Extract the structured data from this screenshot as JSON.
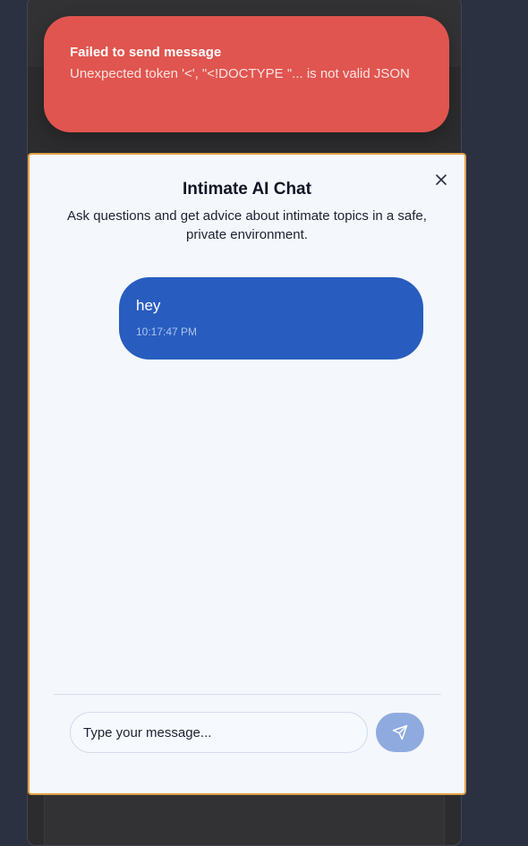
{
  "toast": {
    "title": "Failed to send message",
    "description": "Unexpected token '<', \"<!DOCTYPE \"... is not valid JSON",
    "background_color": "#e0554f"
  },
  "chat": {
    "title": "Intimate AI Chat",
    "subtitle": "Ask questions and get advice about intimate topics in a safe, private environment.",
    "close_icon": "x-icon",
    "messages": [
      {
        "text": "hey",
        "time": "10:17:47 PM",
        "sender": "user"
      }
    ],
    "input": {
      "placeholder": "Type your message...",
      "value": ""
    },
    "send_icon": "send-icon",
    "accent_color": "#285dbf",
    "border_color": "#e3a24a"
  }
}
